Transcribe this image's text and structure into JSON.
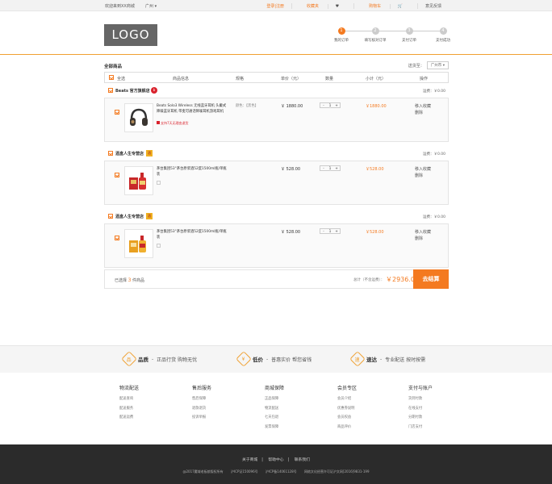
{
  "topbar": {
    "welcome": "欢迎来到XX商城",
    "city": "广州",
    "links": [
      "登录|注册",
      "收藏夹",
      "购物车",
      "意见反馈"
    ]
  },
  "header": {
    "logo": "LOGO",
    "steps": [
      {
        "num": "1",
        "label": "我的订单"
      },
      {
        "num": "2",
        "label": "填写核对订单"
      },
      {
        "num": "3",
        "label": "支付订单"
      },
      {
        "num": "4",
        "label": "支付成功"
      }
    ]
  },
  "cart": {
    "title": "全部商品",
    "ship_label": "送货至：",
    "ship_city": "广州市",
    "columns": {
      "select_all": "全选",
      "info": "商品信息",
      "spec": "规格",
      "unit_price": "单价（元）",
      "qty": "数量",
      "subtotal": "小计（元）",
      "ops": "操作"
    },
    "shops": [
      {
        "name": "Beats 官方旗舰店",
        "freight": "运费：￥0.00",
        "item": {
          "name": "Beats Solo3 Wireless 无线蓝牙耳机 头戴式降噪蓝牙耳机 带麦可通话降噪耳机游戏耳机",
          "promo": "支持7天无理由退货",
          "spec": "颜色：【黑色】",
          "price": "￥ 1880.00",
          "qty": "1",
          "subtotal": "￥1880.00",
          "op_fav": "移入收藏",
          "op_del": "删除"
        }
      },
      {
        "name": "酒盒人生专营店",
        "freight": "运费：￥0.00",
        "item": {
          "name": "茅台集团53°茅台原浆酒52度1500ml瓶/单瓶装",
          "promo": "",
          "spec": "",
          "price": "￥ 528.00",
          "qty": "1",
          "subtotal": "￥528.00",
          "op_fav": "移入收藏",
          "op_del": "删除"
        }
      },
      {
        "name": "酒盒人生专营店",
        "freight": "运费：￥0.00",
        "item": {
          "name": "茅台集团53°茅台原浆酒52度1500ml瓶/单瓶装",
          "promo": "",
          "spec": "",
          "price": "￥ 528.00",
          "qty": "1",
          "subtotal": "￥528.00",
          "op_fav": "移入收藏",
          "op_del": "删除"
        }
      }
    ],
    "summary": {
      "selected_prefix": "已选择",
      "selected_count": "3",
      "selected_suffix": "件商品",
      "total_label": "总计（不含运费）：",
      "total_amount": "￥2936.00",
      "checkout": "去结算"
    }
  },
  "features": [
    {
      "title": "品质",
      "text": "正品行货 购物无忧",
      "icon": "品"
    },
    {
      "title": "低价",
      "text": "普惠实价 帮您省钱",
      "icon": "¥"
    },
    {
      "title": "速达",
      "text": "专业配送 按时按需",
      "icon": "速"
    }
  ],
  "link_cols": [
    {
      "title": "物流配送",
      "links": [
        "配送查询",
        "配送服务",
        "配送运费"
      ]
    },
    {
      "title": "售后服务",
      "links": [
        "售后保障",
        "退款退货",
        "投诉举报"
      ]
    },
    {
      "title": "商城保障",
      "links": [
        "正品保障",
        "物流配送",
        "七天包退",
        "发票保障"
      ]
    },
    {
      "title": "会员专区",
      "links": [
        "会员介绍",
        "优惠券说明",
        "会员权益",
        "商品评价"
      ]
    },
    {
      "title": "支付与账户",
      "links": [
        "货到付款",
        "在线支付",
        "分期付款",
        "门店支付"
      ]
    }
  ],
  "footer": {
    "links": [
      "关于商城",
      "帮助中心",
      "联系我们"
    ],
    "copyright": [
      "@2017魔域老板娘版权所有",
      "沪ICP证150096号",
      "沪ICP备14061128号",
      "网络文化经营许可证沪文网[2016]9831-199"
    ]
  },
  "colors": {
    "accent": "#f47a20",
    "footer_bg": "#2b2b2b"
  }
}
